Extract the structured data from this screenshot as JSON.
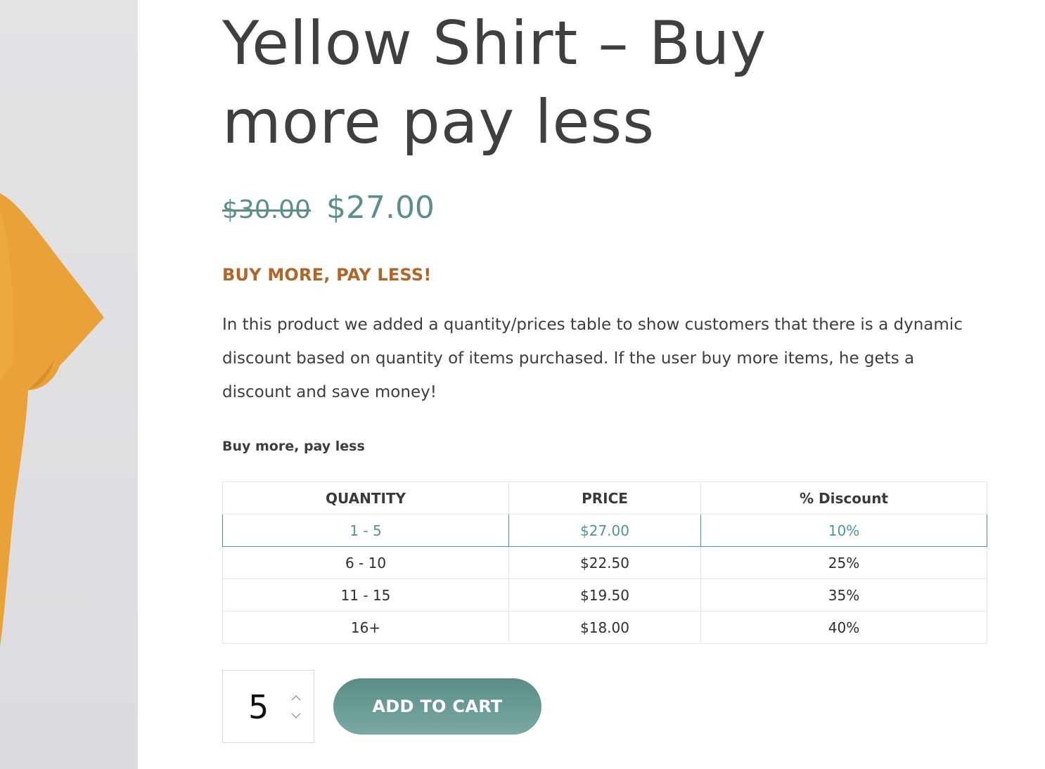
{
  "product": {
    "title": "Yellow Shirt – Buy more pay less",
    "price_regular": "$30.00",
    "price_sale": "$27.00",
    "promo_heading": "BUY MORE, PAY LESS!",
    "description": "In this product we added a quantity/prices table to show customers that there is a dynamic discount based on quantity of items purchased. If the user buy more items, he gets a discount and save money!",
    "image_color": "#e9a23a"
  },
  "tier_table": {
    "caption": "Buy more, pay less",
    "headers": {
      "quantity": "QUANTITY",
      "price": "PRICE",
      "discount": "% Discount"
    },
    "rows": [
      {
        "quantity": "1 - 5",
        "price": "$27.00",
        "discount": "10%",
        "active": true
      },
      {
        "quantity": "6 - 10",
        "price": "$22.50",
        "discount": "25%",
        "active": false
      },
      {
        "quantity": "11 - 15",
        "price": "$19.50",
        "discount": "35%",
        "active": false
      },
      {
        "quantity": "16+",
        "price": "$18.00",
        "discount": "40%",
        "active": false
      }
    ],
    "active_color": "#4f9590"
  },
  "cart": {
    "quantity": "5",
    "add_to_cart_label": "ADD TO CART",
    "button_color": "#6a9a95"
  }
}
